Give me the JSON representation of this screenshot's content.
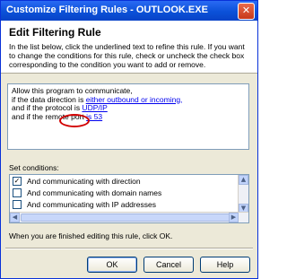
{
  "window": {
    "title": "Customize Filtering Rules - OUTLOOK.EXE",
    "close_glyph": "✕"
  },
  "header": {
    "title": "Edit Filtering Rule",
    "description": "In the list below, click the underlined text to refine this rule. If you want to change the conditions for this rule, check or uncheck the check box corresponding to the condition you want to add or remove."
  },
  "rule": {
    "line1": "Allow this program to communicate,",
    "line2_prefix": "if the data direction is ",
    "line2_link": "either outbound or incoming,",
    "line3_prefix": "and if the protocol is ",
    "line3_link": "UDP/IP",
    "line4_prefix": "and if the remote port ",
    "line4_link": "is 53"
  },
  "conditions": {
    "label": "Set conditions:",
    "items": [
      {
        "label": "And communicating with direction",
        "checked": true
      },
      {
        "label": "And communicating with domain names",
        "checked": false
      },
      {
        "label": "And communicating with IP addresses",
        "checked": false
      }
    ]
  },
  "footer": {
    "hint": "When you are finished editing this rule, click OK."
  },
  "buttons": {
    "ok": "OK",
    "cancel": "Cancel",
    "help": "Help"
  },
  "colors": {
    "title_bar": "#0b51d8",
    "link": "#0000ee",
    "highlight_circle": "#d20000"
  }
}
